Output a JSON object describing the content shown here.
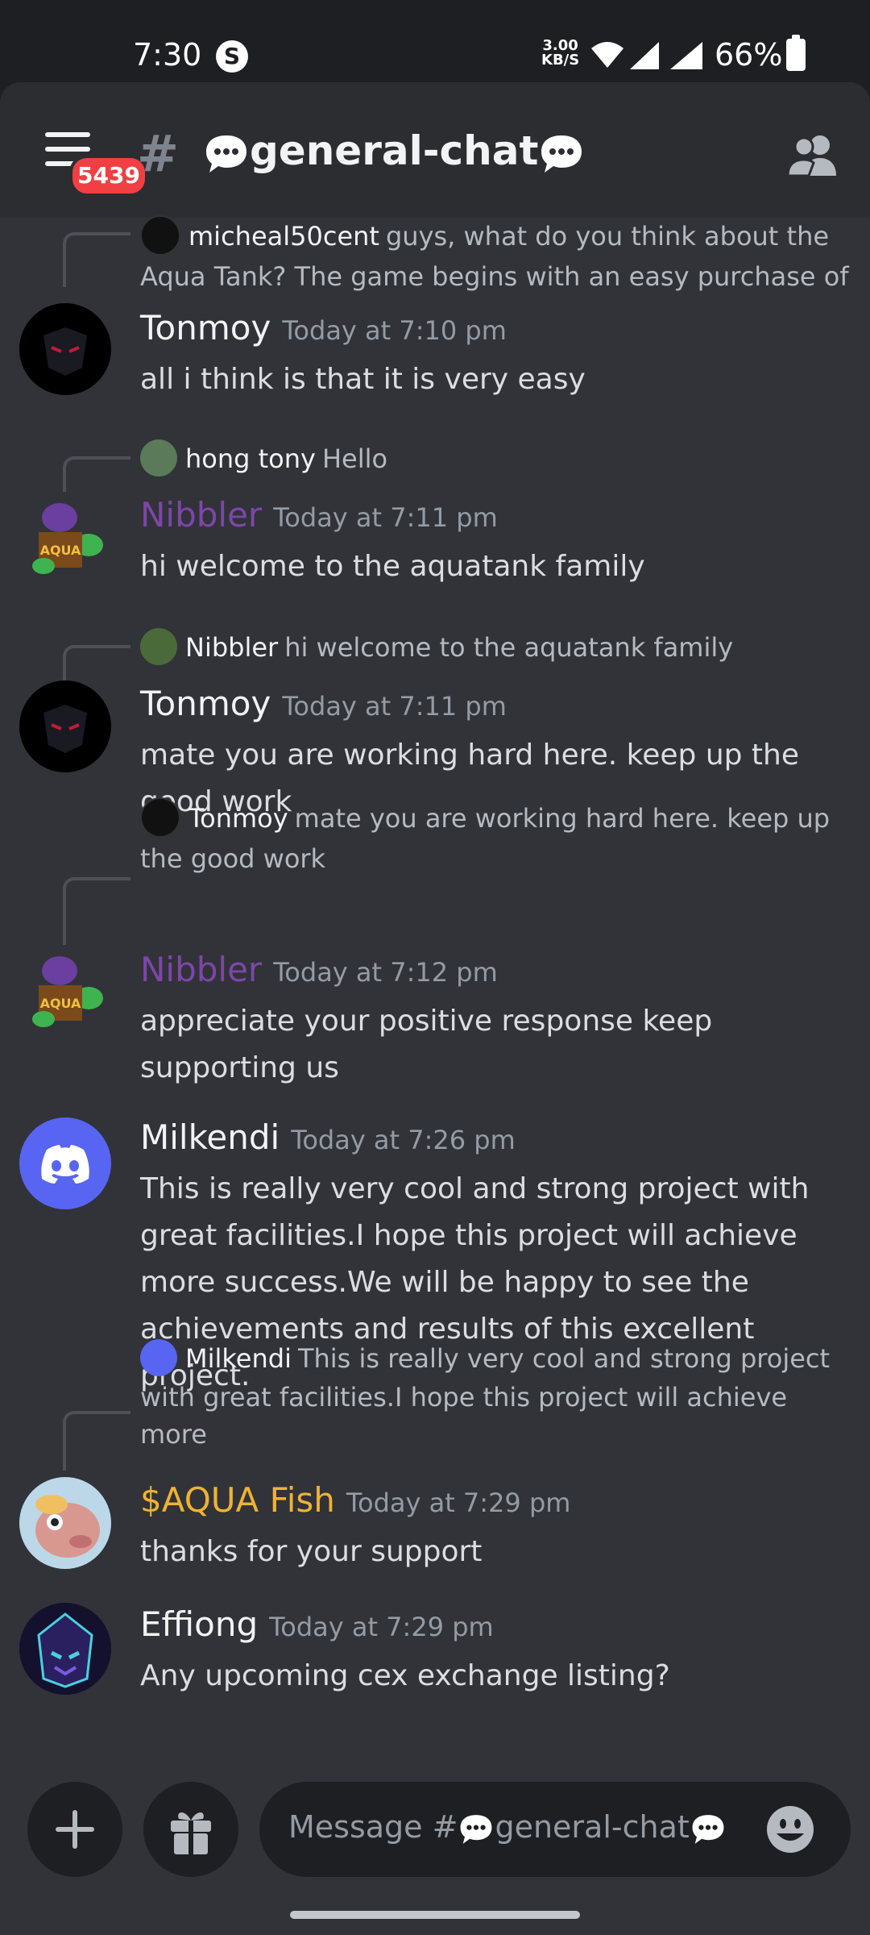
{
  "status_bar": {
    "time": "7:30",
    "s_icon": "S",
    "net_speed_value": "3.00",
    "net_speed_unit": "KB/S",
    "battery": "66%"
  },
  "header": {
    "badge_count": "5439",
    "channel_name": "general-chat"
  },
  "messages": [
    {
      "reply": {
        "name": "micheal50cent",
        "text": "guys, what do you think about the Aqua Tank?     The game begins with an easy purchase of"
      },
      "author": "Tonmoy",
      "timestamp": "Today at 7:10 pm",
      "text": "all i think is that it is very easy"
    },
    {
      "reply": {
        "name": "hong tony",
        "text": "Hello"
      },
      "author": "Nibbler",
      "timestamp": "Today at 7:11 pm",
      "text": "hi welcome to the aquatank family"
    },
    {
      "reply": {
        "name": "Nibbler",
        "text": "hi welcome to the aquatank family"
      },
      "author": "Tonmoy",
      "timestamp": "Today at 7:11 pm",
      "text": "mate you are working hard here. keep up the good work"
    },
    {
      "reply": {
        "name": "Tonmoy",
        "text": "mate you are working hard here. keep up the good work"
      },
      "author": "Nibbler",
      "timestamp": "Today at 7:12 pm",
      "text": "appreciate your positive response keep supporting us"
    },
    {
      "author": "Milkendi",
      "timestamp": "Today at 7:26 pm",
      "text": "This is really very cool and strong project with great facilities.I hope this project will achieve more success.We will be happy to see the achievements and results of this excellent project."
    },
    {
      "reply": {
        "name": "Milkendi",
        "text": "This is really very cool and strong project with great facilities.I hope this project will achieve more"
      },
      "author": "$AQUA Fish",
      "timestamp": "Today at 7:29 pm",
      "text": "thanks for your support"
    },
    {
      "author": "Effiong",
      "timestamp": "Today at 7:29 pm",
      "text": "Any upcoming cex exchange listing?"
    }
  ],
  "composer": {
    "placeholder_prefix": "Message #",
    "placeholder_channel": "general-chat"
  },
  "colors": {
    "background": "#313338",
    "header": "#2b2d31",
    "nibbler_role": "#7d46a8",
    "aqua_role": "#f0b232",
    "discord_blurple": "#5865f2",
    "badge_red": "#f23f43"
  }
}
